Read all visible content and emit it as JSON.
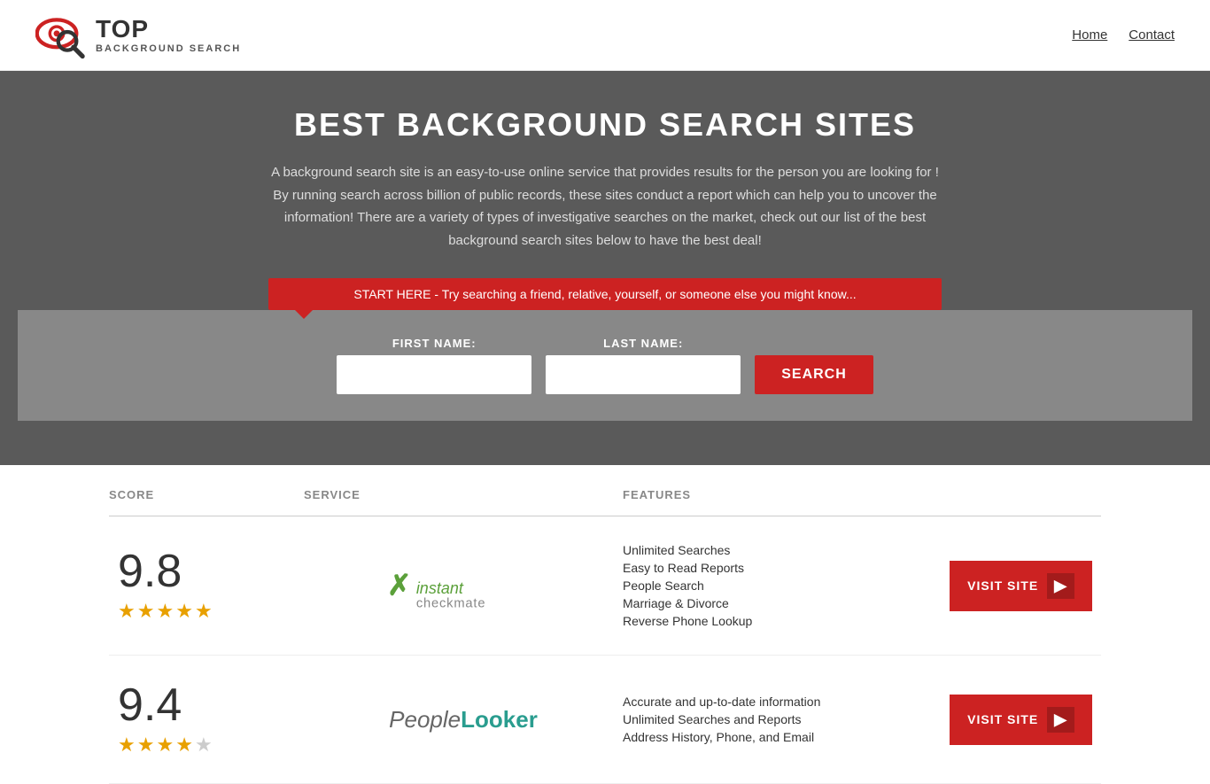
{
  "header": {
    "logo_top": "TOP",
    "logo_bottom": "BACKGROUND SEARCH",
    "nav": {
      "home": "Home",
      "contact": "Contact"
    }
  },
  "hero": {
    "title": "BEST BACKGROUND SEARCH SITES",
    "description": "A background search site is an easy-to-use online service that provides results  for the person you are looking for ! By  running  search across billion of public records, these sites conduct  a report which can help you to uncover the information! There are a variety of types of investigative searches on the market, check out our  list of the best background search sites below to have the best deal!",
    "search_banner": "START HERE - Try searching a friend, relative, yourself, or someone else you might know..."
  },
  "search_form": {
    "first_name_label": "FIRST NAME:",
    "last_name_label": "LAST NAME:",
    "button_label": "SEARCH"
  },
  "table": {
    "headers": {
      "score": "SCORE",
      "service": "SERVICE",
      "features": "FEATURES",
      "action": ""
    },
    "rows": [
      {
        "score": "9.8",
        "stars": 4.5,
        "service_name": "Instant Checkmate",
        "features": [
          "Unlimited Searches",
          "Easy to Read Reports",
          "People Search",
          "Marriage & Divorce",
          "Reverse Phone Lookup"
        ],
        "visit_label": "VISIT SITE"
      },
      {
        "score": "9.4",
        "stars": 4,
        "service_name": "PeopleLooker",
        "features": [
          "Accurate and up-to-date information",
          "Unlimited Searches and Reports",
          "Address History, Phone, and Email"
        ],
        "visit_label": "VISIT SITE"
      }
    ]
  },
  "colors": {
    "accent_red": "#cc2222",
    "star_gold": "#e8a000",
    "header_gray": "#5a5a5a",
    "table_header_gray": "#888888"
  }
}
